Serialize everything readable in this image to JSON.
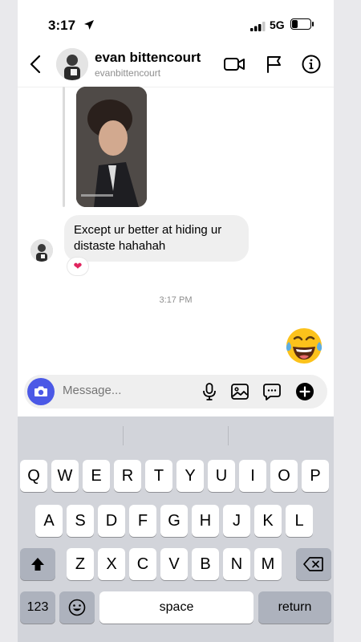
{
  "status": {
    "time": "3:17",
    "network": "5G"
  },
  "header": {
    "name": "evan bittencourt",
    "username": "evanbittencourt"
  },
  "chat": {
    "message": "Except ur better at hiding ur distaste hahahah",
    "reaction": "❤",
    "timestamp": "3:17 PM"
  },
  "composer": {
    "placeholder": "Message..."
  },
  "keyboard": {
    "row1": [
      "Q",
      "W",
      "E",
      "R",
      "T",
      "Y",
      "U",
      "I",
      "O",
      "P"
    ],
    "row2": [
      "A",
      "S",
      "D",
      "F",
      "G",
      "H",
      "J",
      "K",
      "L"
    ],
    "row3": [
      "Z",
      "X",
      "C",
      "V",
      "B",
      "N",
      "M"
    ],
    "numbers": "123",
    "space": "space",
    "return": "return"
  },
  "colors": {
    "accent": "#4b59e6",
    "reaction": "#e0245e"
  }
}
